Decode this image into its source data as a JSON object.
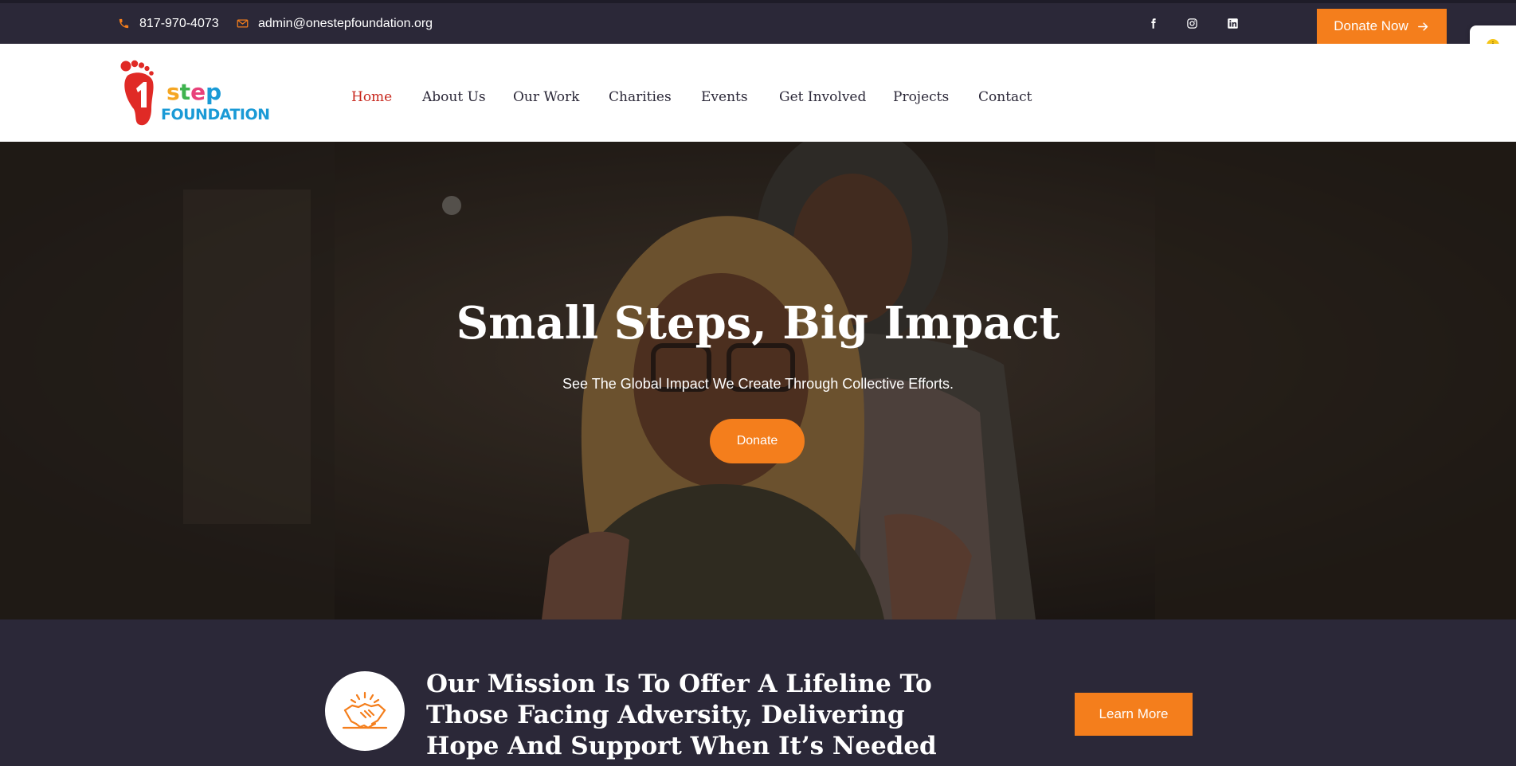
{
  "topbar": {
    "phone": "817-970-4073",
    "email": "admin@onestepfoundation.org",
    "social": [
      "facebook-icon",
      "instagram-icon",
      "linkedin-icon"
    ],
    "donate_now_label": "Donate Now"
  },
  "header": {
    "logo": {
      "number": "1",
      "word_step": "step",
      "word_foundation": "FOUNDATION"
    },
    "nav": [
      {
        "label": "Home",
        "active": true
      },
      {
        "label": "About Us"
      },
      {
        "label": "Our Work"
      },
      {
        "label": "Charities"
      },
      {
        "label": "Events"
      },
      {
        "label": "Get Involved"
      },
      {
        "label": "Projects"
      },
      {
        "label": "Contact"
      }
    ]
  },
  "hero": {
    "title": "Small Steps, Big Impact",
    "subtitle": "See The Global Impact We Create Through Collective Efforts.",
    "donate_label": "Donate"
  },
  "mission": {
    "icon": "handshake-icon",
    "text": "Our Mission Is To Offer A Lifeline To Those Facing Adversity, Delivering Hope And Support When It’s Needed Most",
    "learn_more_label": "Learn More"
  },
  "colors": {
    "accent": "#f47e1c",
    "dark": "#2b2838",
    "nav_active": "#c8281e",
    "logo_blue": "#1a9ad6",
    "logo_red": "#e02a26"
  }
}
